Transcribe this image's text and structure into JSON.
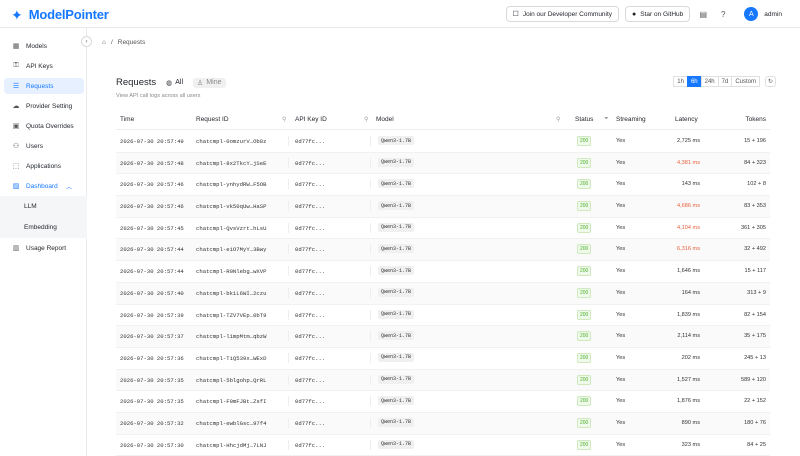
{
  "app": {
    "name": "ModelPointer"
  },
  "topbar": {
    "community_label": "Join our Developer Community",
    "github_label": "Star on GitHub",
    "user_initial": "A",
    "user_name": "admin"
  },
  "sidebar": {
    "items": [
      {
        "label": "Models",
        "icon": "models-icon"
      },
      {
        "label": "API Keys",
        "icon": "key-icon"
      },
      {
        "label": "Requests",
        "icon": "list-icon"
      },
      {
        "label": "Provider Setting",
        "icon": "cloud-icon"
      },
      {
        "label": "Quota Overrides",
        "icon": "quota-icon"
      },
      {
        "label": "Users",
        "icon": "users-icon"
      },
      {
        "label": "Applications",
        "icon": "applications-icon"
      },
      {
        "label": "Dashboard",
        "icon": "dashboard-icon"
      },
      {
        "label": "LLM",
        "icon": ""
      },
      {
        "label": "Embedding",
        "icon": ""
      },
      {
        "label": "Usage Report",
        "icon": "report-icon"
      }
    ]
  },
  "breadcrumb": {
    "sep": "/",
    "current": "Requests"
  },
  "page": {
    "title": "Requests",
    "scope_all": "All",
    "scope_mine": "Mine",
    "subtitle": "View API call logs across all users",
    "ranges": [
      "1h",
      "6h",
      "24h",
      "7d",
      "Custom"
    ],
    "active_range": "6h"
  },
  "table": {
    "columns": [
      "Time",
      "Request ID",
      "API Key ID",
      "Model",
      "Status",
      "Streaming",
      "Latency",
      "Tokens"
    ],
    "rows": [
      [
        "2026-07-30 20:57:49",
        "chatcmpl-0omzurV…Ob8z",
        "0d77fc...",
        "Qwen3-1.7B",
        "200",
        "Yes",
        "2,725 ms",
        "15 + 196"
      ],
      [
        "2026-07-30 20:57:48",
        "chatcmpl-8x2TkcY…jSeE",
        "0d77fc...",
        "Qwen3-1.7B",
        "200",
        "Yes",
        "4,381 ms",
        "84 + 323"
      ],
      [
        "2026-07-30 20:57:46",
        "chatcmpl-ynhydRW…F5OB",
        "0d77fc...",
        "Qwen3-1.7B",
        "200",
        "Yes",
        "143 ms",
        "102 + 8"
      ],
      [
        "2026-07-30 20:57:46",
        "chatcmpl-vk50qUw…HaSP",
        "0d77fc...",
        "Qwen3-1.7B",
        "200",
        "Yes",
        "4,686 ms",
        "83 + 353"
      ],
      [
        "2026-07-30 20:57:45",
        "chatcmpl-QvsVzrt…hLsU",
        "0d77fc...",
        "Qwen3-1.7B",
        "200",
        "Yes",
        "4,104 ms",
        "361 + 305"
      ],
      [
        "2026-07-30 20:57:44",
        "chatcmpl-eiO7MyY…3Bwy",
        "0d77fc...",
        "Qwen3-1.7B",
        "200",
        "Yes",
        "6,316 ms",
        "32 + 492"
      ],
      [
        "2026-07-30 20:57:44",
        "chatcmpl-R0Nlebg…wXVP",
        "0d77fc...",
        "Qwen3-1.7B",
        "200",
        "Yes",
        "1,646 ms",
        "15 + 117"
      ],
      [
        "2026-07-30 20:57:40",
        "chatcmpl-bk1L6WI…2czu",
        "0d77fc...",
        "Qwen3-1.7B",
        "200",
        "Yes",
        "164 ms",
        "313 + 9"
      ],
      [
        "2026-07-30 20:57:39",
        "chatcmpl-TZV7VEp…0bT9",
        "0d77fc...",
        "Qwen3-1.7B",
        "200",
        "Yes",
        "1,839 ms",
        "82 + 154"
      ],
      [
        "2026-07-30 20:57:37",
        "chatcmpl-l1mpMtm…qbzW",
        "0d77fc...",
        "Qwen3-1.7B",
        "200",
        "Yes",
        "2,114 ms",
        "35 + 175"
      ],
      [
        "2026-07-30 20:57:36",
        "chatcmpl-TiQ539x…WExD",
        "0d77fc...",
        "Qwen3-1.7B",
        "200",
        "Yes",
        "202 ms",
        "245 + 13"
      ],
      [
        "2026-07-30 20:57:35",
        "chatcmpl-5blgohp…QrRL",
        "0d77fc...",
        "Qwen3-1.7B",
        "200",
        "Yes",
        "1,527 ms",
        "589 + 120"
      ],
      [
        "2026-07-30 20:57:35",
        "chatcmpl-F0mFJBt…ZsfI",
        "0d77fc...",
        "Qwen3-1.7B",
        "200",
        "Yes",
        "1,876 ms",
        "22 + 152"
      ],
      [
        "2026-07-30 20:57:32",
        "chatcmpl-ewblGsc…97f4",
        "0d77fc...",
        "Qwen3-1.7B",
        "200",
        "Yes",
        "890 ms",
        "180 + 76"
      ],
      [
        "2026-07-30 20:57:30",
        "chatcmpl-HhcjdMj…7LNJ",
        "0d77fc...",
        "Qwen3-1.7B",
        "200",
        "Yes",
        "323 ms",
        "84 + 25"
      ]
    ],
    "warn_latency": [
      "4,381 ms",
      "4,686 ms",
      "4,104 ms",
      "6,316 ms"
    ],
    "colors": {
      "accent": "#1677ff",
      "success": "#4cae2c",
      "warn": "#e8603c"
    }
  }
}
